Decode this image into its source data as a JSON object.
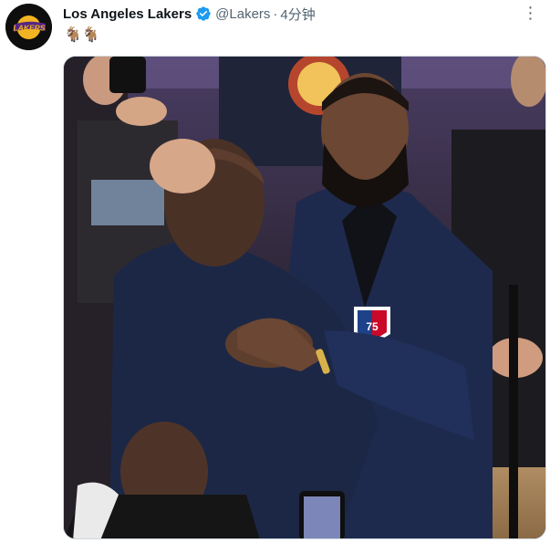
{
  "author": {
    "name": "Los Angeles Lakers",
    "handle": "@Lakers",
    "separator": "·",
    "timestamp": "4分钟",
    "verified": true,
    "avatar_logo_text": "LAKERS",
    "avatar_colors": {
      "bg": "#0e0e0e",
      "gold": "#f2b422",
      "purple": "#552583"
    }
  },
  "tweet": {
    "text": "🐐🐐"
  },
  "menu": {
    "more_icon": "⋮"
  },
  "media": {
    "type": "photo",
    "nba75_logo_text": "75"
  },
  "colors": {
    "verified_blue": "#1d9bf0",
    "muted_text": "#536471",
    "primary_text": "#0f1419",
    "border": "#cfd9de"
  }
}
